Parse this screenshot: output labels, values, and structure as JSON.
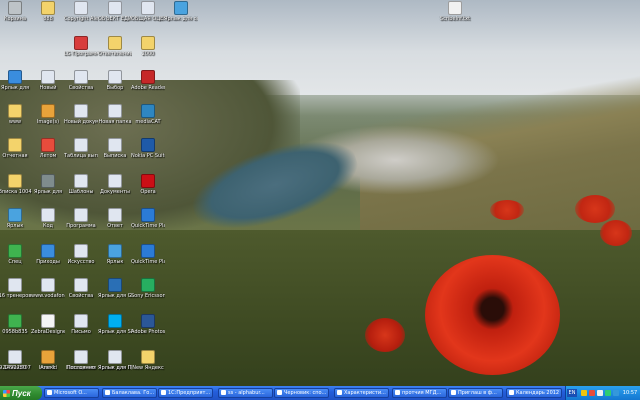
{
  "desktop": {
    "icons": [
      {
        "label": "Корзина",
        "icon": "recycle-bin-icon",
        "color": "#bdc3c7"
      },
      {
        "label": "888",
        "icon": "folder-icon",
        "color": "#f3d36b"
      },
      {
        "label": "Copyright Alex Sov",
        "icon": "document-icon",
        "color": "#e0e6f0"
      },
      {
        "label": "ОБЪЕКТ ЕДИНОЙ",
        "icon": "document-icon",
        "color": "#e0e6f0"
      },
      {
        "label": "ОБЩАЯ ОЦЕНКА",
        "icon": "document-icon",
        "color": "#e0e6f0"
      },
      {
        "label": "Ярлык для сетевого",
        "icon": "network-icon",
        "color": "#4aa3df"
      },
      {
        "label": "ScribeInf.txt",
        "icon": "notepad-icon",
        "color": "#f1f1f1"
      },
      {
        "label": "LG Программы",
        "icon": "lg-icon",
        "color": "#d83c3c"
      },
      {
        "label": "Ответвление",
        "icon": "folder-icon",
        "color": "#f3d36b"
      },
      {
        "label": "2000",
        "icon": "folder-icon",
        "color": "#f3d36b"
      },
      {
        "label": "Ярлык для",
        "icon": "ie-icon",
        "color": "#3a8dde"
      },
      {
        "label": "Новый",
        "icon": "document-icon",
        "color": "#e0e6f0"
      },
      {
        "label": "Свойства",
        "icon": "document-icon",
        "color": "#e0e6f0"
      },
      {
        "label": "Выбор",
        "icon": "document-icon",
        "color": "#e0e6f0"
      },
      {
        "label": "Adobe Reader 9",
        "icon": "adobe-reader-icon",
        "color": "#c62828"
      },
      {
        "label": "www",
        "icon": "folder-icon",
        "color": "#f3d36b"
      },
      {
        "label": "Image(s)",
        "icon": "image-icon",
        "color": "#e9a33a"
      },
      {
        "label": "Новый документ",
        "icon": "document-icon",
        "color": "#e0e6f0"
      },
      {
        "label": "Новая папка",
        "icon": "document-icon",
        "color": "#e0e6f0"
      },
      {
        "label": "mediaCAT",
        "icon": "media-icon",
        "color": "#2e86c1"
      },
      {
        "label": "Отчетная",
        "icon": "folder-icon",
        "color": "#f3d36b"
      },
      {
        "label": "Летом",
        "icon": "pdf-icon",
        "color": "#e74c3c"
      },
      {
        "label": "Таблица выписок",
        "icon": "document-icon",
        "color": "#e0e6f0"
      },
      {
        "label": "Выписка",
        "icon": "document-icon",
        "color": "#e0e6f0"
      },
      {
        "label": "Nokia PC Suite",
        "icon": "nokia-icon",
        "color": "#1e5aa8"
      },
      {
        "label": "Вписка 1004",
        "icon": "folder-icon",
        "color": "#f3d36b"
      },
      {
        "label": "Ярлык для",
        "icon": "shortcut-icon",
        "color": "#7f8c8d"
      },
      {
        "label": "Шаблоны",
        "icon": "document-icon",
        "color": "#e0e6f0"
      },
      {
        "label": "Документы",
        "icon": "document-icon",
        "color": "#e0e6f0"
      },
      {
        "label": "Opera",
        "icon": "opera-icon",
        "color": "#cc0f16"
      },
      {
        "label": "Ярлык",
        "icon": "network-icon",
        "color": "#4aa3df"
      },
      {
        "label": "Код",
        "icon": "document-icon",
        "color": "#e0e6f0"
      },
      {
        "label": "Программа",
        "icon": "document-icon",
        "color": "#e0e6f0"
      },
      {
        "label": "Ответ",
        "icon": "document-icon",
        "color": "#e0e6f0"
      },
      {
        "label": "QuickTime Player",
        "icon": "quicktime-icon",
        "color": "#2b7bd6"
      },
      {
        "label": "Спец",
        "icon": "chrome-icon",
        "color": "#3fb34f"
      },
      {
        "label": "Приходы",
        "icon": "ie-icon",
        "color": "#3a8dde"
      },
      {
        "label": "Искусство",
        "icon": "document-icon",
        "color": "#e0e6f0"
      },
      {
        "label": "Ярлык",
        "icon": "network-icon",
        "color": "#4aa3df"
      },
      {
        "label": "QuickTime Player",
        "icon": "quicktime-icon",
        "color": "#2b7bd6"
      },
      {
        "label": "16 тренеров",
        "icon": "document-icon",
        "color": "#e0e6f0"
      },
      {
        "label": "www.vodafone",
        "icon": "document-icon",
        "color": "#e0e6f0"
      },
      {
        "label": "Свойства",
        "icon": "document-icon",
        "color": "#e0e6f0"
      },
      {
        "label": "Ярлык для GoogleEarth",
        "icon": "earth-icon",
        "color": "#2a6fb5"
      },
      {
        "label": "Sony Ericsson PC Suite",
        "icon": "sony-icon",
        "color": "#27ae60"
      },
      {
        "label": "0958b835",
        "icon": "chrome-icon",
        "color": "#3fb34f"
      },
      {
        "label": "ZebraDesigner",
        "icon": "zebra-icon",
        "color": "#f5f5f5"
      },
      {
        "label": "Письмо",
        "icon": "document-icon",
        "color": "#e0e6f0"
      },
      {
        "label": "Ярлык для Skype",
        "icon": "skype-icon",
        "color": "#00aff0"
      },
      {
        "label": "Adobe Photoshop",
        "icon": "photoshop-icon",
        "color": "#2b5797"
      },
      {
        "label": "92234ab697",
        "icon": "chrome-icon",
        "color": "#3fb34f"
      },
      {
        "label": "Imeniki",
        "icon": "chrome-icon",
        "color": "#3fb34f"
      },
      {
        "label": "Посещения",
        "icon": "document-icon",
        "color": "#e0e6f0"
      },
      {
        "label": "Ярлык для ГРАФА",
        "icon": "folder-icon",
        "color": "#f3d36b"
      },
      {
        "label": "New Яндекс",
        "icon": "folder-icon",
        "color": "#f3d36b"
      },
      {
        "label": "1492750",
        "icon": "document-icon",
        "color": "#e0e6f0"
      },
      {
        "label": "Алекс",
        "icon": "image-icon",
        "color": "#e9a33a"
      },
      {
        "label": "Постоянно",
        "icon": "document-icon",
        "color": "#e0e6f0"
      },
      {
        "label": "Ярлык для Презентации",
        "icon": "document-icon",
        "color": "#e0e6f0"
      }
    ]
  },
  "taskbar": {
    "start_label": "Пуск",
    "buttons": [
      {
        "label": "Microsoft O..."
      },
      {
        "label": "Балаклава. Го..."
      },
      {
        "label": "1С:Предприят..."
      },
      {
        "label": "ss - alphabur..."
      },
      {
        "label": "Черновик: спо..."
      },
      {
        "label": "Характеристи..."
      },
      {
        "label": "протчия МГД..."
      },
      {
        "label": "Приглаш в ф..."
      },
      {
        "label": "Календарь 2012"
      }
    ],
    "tray": {
      "language": "EN",
      "clock": "10:57"
    }
  }
}
